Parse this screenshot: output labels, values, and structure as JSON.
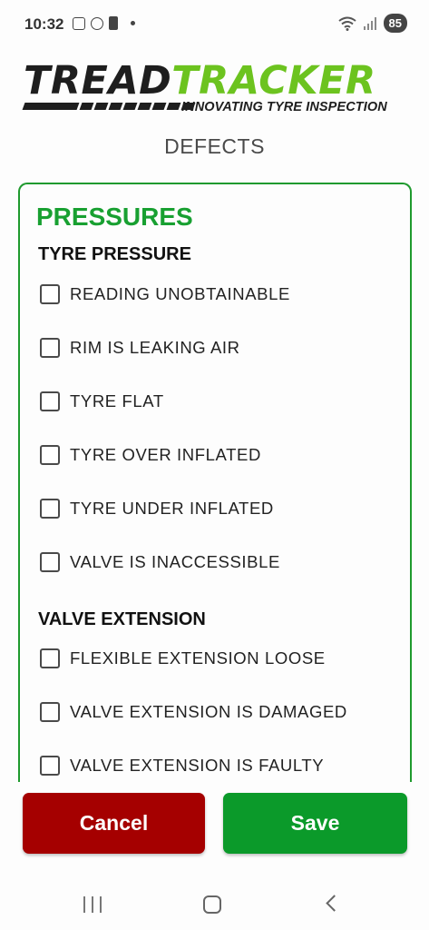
{
  "status_bar": {
    "time": "10:32",
    "battery": "85",
    "icons": [
      "screenshot-icon",
      "accessibility-icon",
      "battery-saver-icon",
      "notification-dot-icon",
      "wifi-icon",
      "signal-icon"
    ]
  },
  "logo": {
    "word_part1": "TREAD",
    "word_part2": "TRACKER",
    "tagline": "INNOVATING TYRE INSPECTION",
    "colors": {
      "dark": "#1e1e1e",
      "green": "#6cc31f"
    }
  },
  "page": {
    "title": "DEFECTS"
  },
  "defects": {
    "section_title": "PRESSURES",
    "groups": [
      {
        "title": "TYRE PRESSURE",
        "options": [
          "READING UNOBTAINABLE",
          "RIM IS LEAKING AIR",
          "TYRE FLAT",
          "TYRE OVER INFLATED",
          "TYRE UNDER INFLATED",
          "VALVE IS INACCESSIBLE"
        ]
      },
      {
        "title": "VALVE EXTENSION",
        "options": [
          "FLEXIBLE EXTENSION LOOSE",
          "VALVE EXTENSION IS DAMAGED",
          "VALVE EXTENSION IS FAULTY"
        ]
      }
    ]
  },
  "actions": {
    "cancel_label": "Cancel",
    "save_label": "Save",
    "cancel_color": "#a50000",
    "save_color": "#0b9a2a"
  },
  "theme": {
    "accent": "#1f9a2e"
  }
}
